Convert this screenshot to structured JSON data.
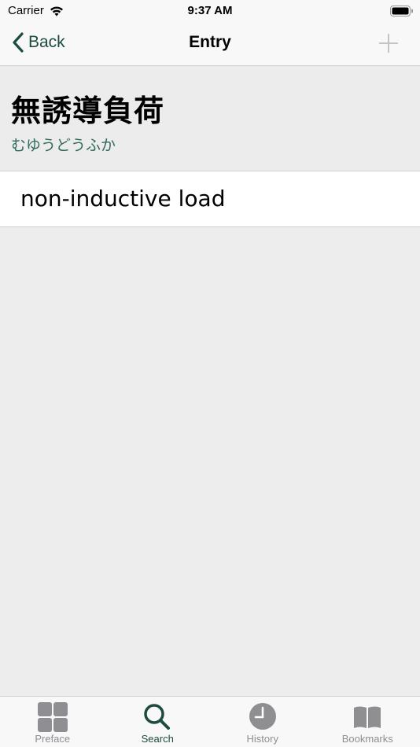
{
  "status_bar": {
    "carrier": "Carrier",
    "time": "9:37 AM"
  },
  "nav": {
    "back_label": "Back",
    "title": "Entry"
  },
  "entry": {
    "headword": "無誘導負荷",
    "reading": "むゆうどうふか",
    "definition": "non-inductive load"
  },
  "tabs": [
    {
      "label": "Preface",
      "icon": "grid-icon",
      "active": false
    },
    {
      "label": "Search",
      "icon": "search-icon",
      "active": true
    },
    {
      "label": "History",
      "icon": "clock-icon",
      "active": false
    },
    {
      "label": "Bookmarks",
      "icon": "book-icon",
      "active": false
    }
  ],
  "colors": {
    "accent": "#1c4b40",
    "reading": "#2f6b5c",
    "inactive": "#8e8e93",
    "background": "#ededed"
  }
}
